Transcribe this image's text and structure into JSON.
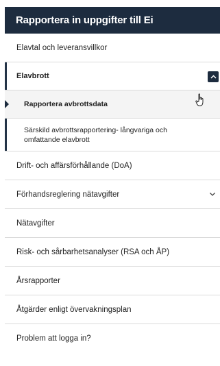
{
  "header": {
    "title": "Rapportera in uppgifter till Ei"
  },
  "items_before": [
    {
      "label": "Elavtal och leveransvillkor"
    }
  ],
  "section": {
    "label": "Elavbrott",
    "toggle_icon": "chevron-up-icon",
    "subitems": [
      {
        "label": "Rapportera avbrottsdata",
        "active": true
      },
      {
        "label": "Särskild avbrottsrapportering- långvariga och omfattande elavbrott",
        "active": false
      }
    ]
  },
  "items_after": [
    {
      "label": "Drift- och affärsförhållande (DoA)"
    },
    {
      "label": "Förhandsreglering nätavgifter",
      "expand_icon": "chevron-down-icon"
    },
    {
      "label": "Nätavgifter"
    },
    {
      "label": "Risk- och sårbarhetsanalyser (RSA och ÅP)"
    },
    {
      "label": "Årsrapporter"
    },
    {
      "label": "Åtgärder enligt övervakningsplan"
    },
    {
      "label": "Problem att logga in?"
    }
  ],
  "colors": {
    "header_bg": "#1d2c3f",
    "active_bg": "#f4f4f4",
    "divider": "#dadada"
  }
}
